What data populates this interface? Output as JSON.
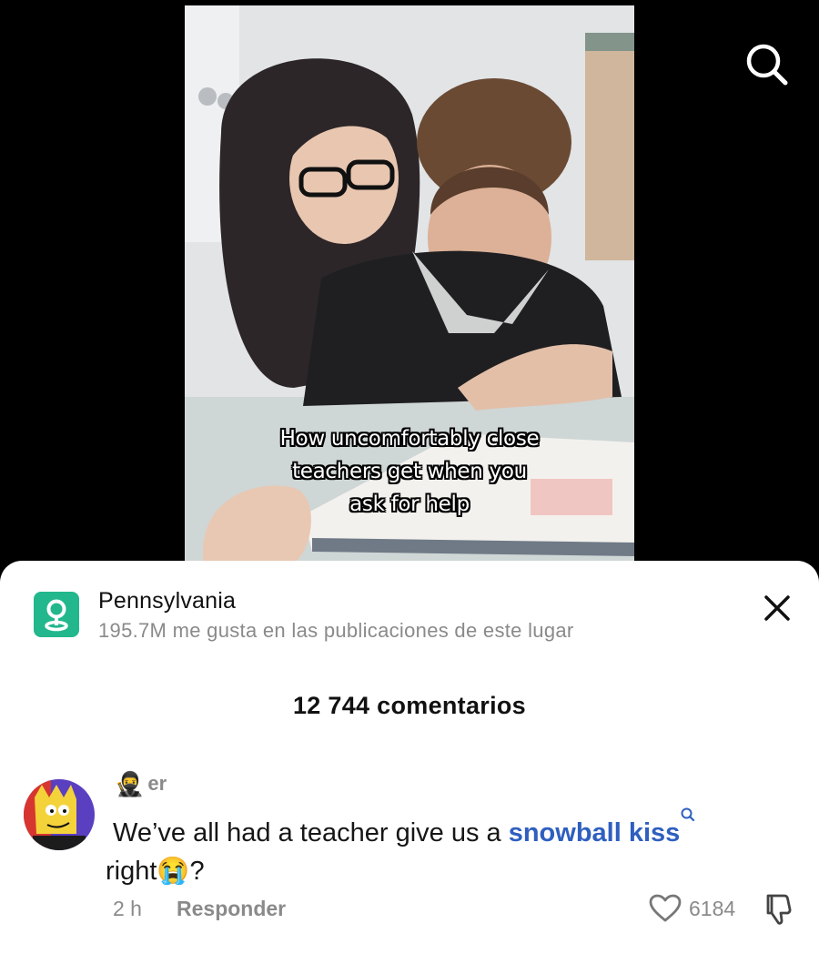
{
  "video": {
    "caption_lines": [
      "How uncomfortably close",
      "teachers get when you",
      "ask for help"
    ]
  },
  "header": {
    "search_icon": "search-icon"
  },
  "place": {
    "icon": "location-pin-icon",
    "name": "Pennsylvania",
    "stats": "195.7M me gusta en las publicaciones de este lugar",
    "close_icon": "close-icon"
  },
  "comments": {
    "count_label": "12 744 comentarios",
    "items": [
      {
        "username_emoji": "🥷",
        "username": "er",
        "text_before": "We’ve all had a teacher give us a ",
        "link_text": "snowball kiss",
        "text_after": " right",
        "trailing_emoji": "😭",
        "text_end": "?",
        "time": "2 h",
        "reply_label": "Responder",
        "likes": "6184",
        "like_icon": "heart-icon",
        "dislike_icon": "thumbs-down-icon"
      }
    ]
  }
}
